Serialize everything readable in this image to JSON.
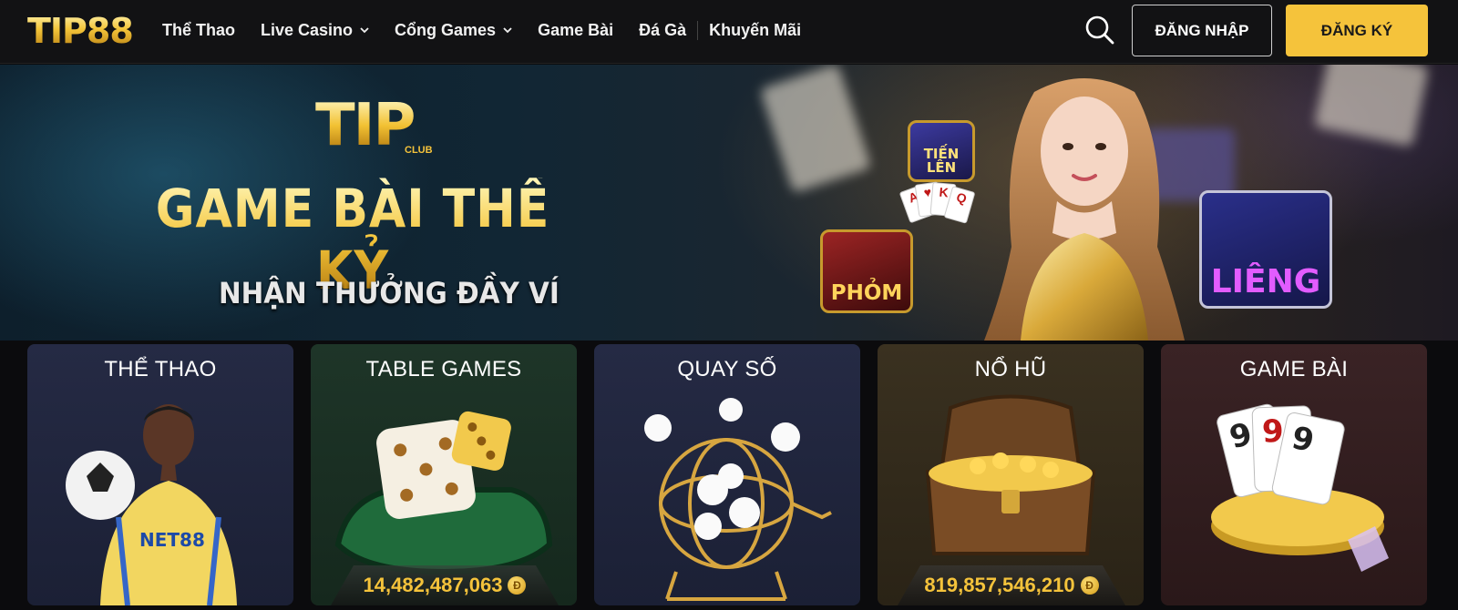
{
  "header": {
    "logo_text": "TIP88",
    "nav": [
      {
        "label": "Thể Thao",
        "dropdown": false
      },
      {
        "label": "Live Casino",
        "dropdown": true
      },
      {
        "label": "Cổng Games",
        "dropdown": true
      },
      {
        "label": "Game Bài",
        "dropdown": false
      },
      {
        "label": "Đá Gà",
        "dropdown": false
      },
      {
        "label": "Khuyến Mãi",
        "dropdown": false
      }
    ],
    "search_icon": "search-icon",
    "login_label": "ĐĂNG NHẬP",
    "register_label": "ĐĂNG KÝ"
  },
  "banner": {
    "brand": "TIP",
    "brand_sub": "CLUB",
    "title": "GAME BÀI THẾ KỶ",
    "subtitle": "NHẬN THƯỞNG ĐẦY VÍ",
    "tiles": [
      "TIẾN LÊN",
      "PHỎM",
      "LIÊNG"
    ]
  },
  "categories": [
    {
      "title": "THỂ THAO",
      "jackpot": ""
    },
    {
      "title": "TABLE GAMES",
      "jackpot": "14,482,487,063"
    },
    {
      "title": "QUAY SỐ",
      "jackpot": ""
    },
    {
      "title": "NỔ HŨ",
      "jackpot": "819,857,546,210"
    },
    {
      "title": "GAME BÀI",
      "jackpot": ""
    }
  ],
  "colors": {
    "accent": "#f5c33b",
    "header_bg": "#121214",
    "page_bg": "#0b0b0d"
  }
}
